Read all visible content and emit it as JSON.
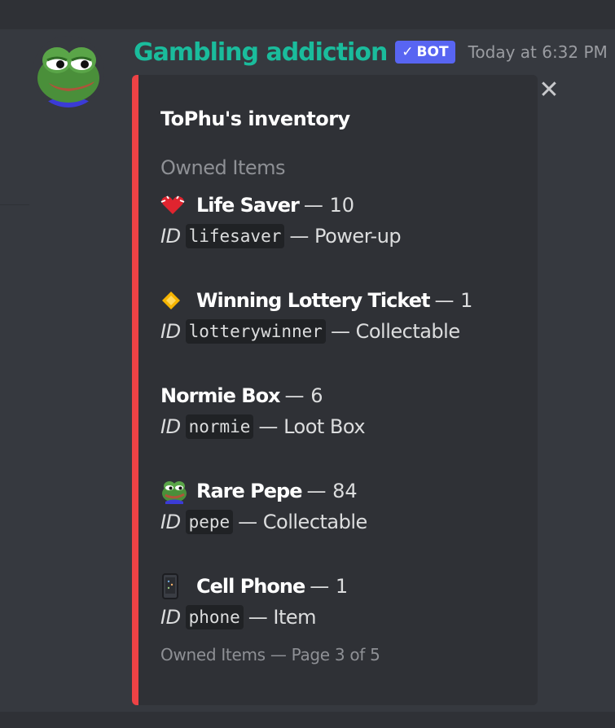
{
  "message": {
    "username": "Gambling addiction",
    "badge": "BOT",
    "timestamp": "Today at 6:32 PM"
  },
  "embed": {
    "close_symbol": "✕",
    "title": "ToPhu's inventory",
    "section_label": "Owned Items",
    "id_label": "ID",
    "separator": "—",
    "items": [
      {
        "icon": "heart-icon",
        "name": "Life Saver",
        "count": "10",
        "id": "lifesaver",
        "type": "Power-up"
      },
      {
        "icon": "ticket-icon",
        "name": "Winning Lottery Ticket",
        "count": "1",
        "id": "lotterywinner",
        "type": "Collectable"
      },
      {
        "icon": "",
        "name": "Normie Box",
        "count": "6",
        "id": "normie",
        "type": "Loot Box"
      },
      {
        "icon": "pepe-icon",
        "name": "Rare Pepe",
        "count": "84",
        "id": "pepe",
        "type": "Collectable"
      },
      {
        "icon": "phone-icon",
        "name": "Cell Phone",
        "count": "1",
        "id": "phone",
        "type": "Item"
      }
    ],
    "footer": "Owned Items — Page 3 of 5"
  },
  "colors": {
    "background": "#36393f",
    "embed_background": "#2f3136",
    "embed_accent": "#ed4245",
    "username": "#1abc9c",
    "bot_badge": "#5865f2"
  }
}
